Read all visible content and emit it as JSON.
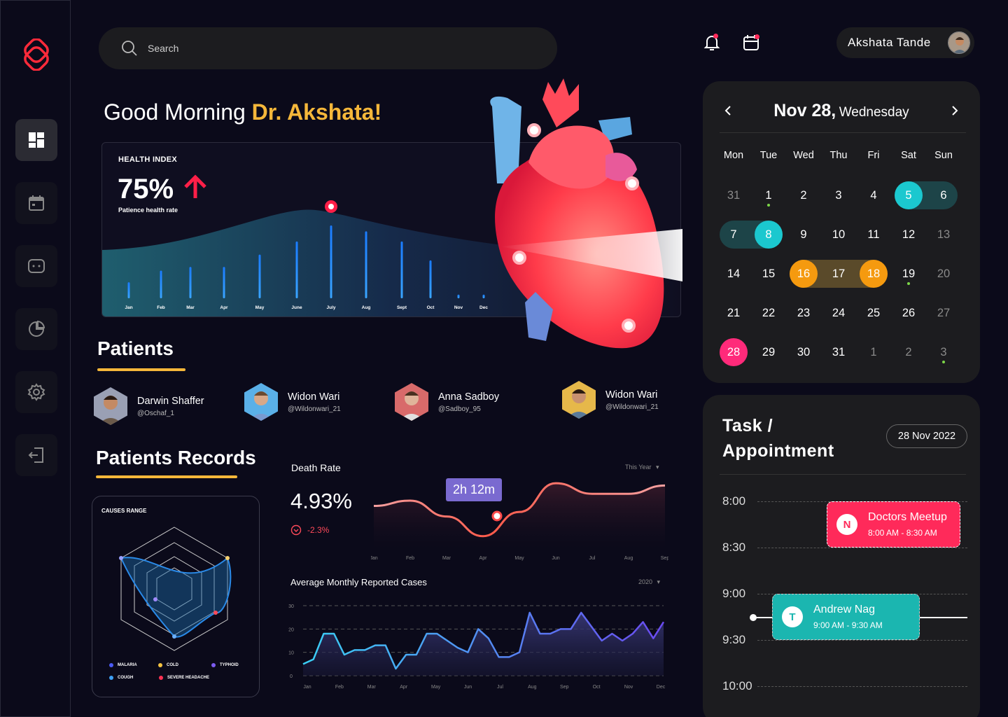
{
  "search": {
    "placeholder": "Search"
  },
  "user": {
    "name": "Akshata Tande"
  },
  "greeting": {
    "prefix": "Good Morning ",
    "name": "Dr. Akshata!"
  },
  "health_index": {
    "title": "HEALTH INDEX",
    "value": "75%",
    "subtitle": "Patience health rate",
    "chart_data": {
      "type": "bar",
      "categories": [
        "Jan",
        "Feb",
        "Mar",
        "Apr",
        "May",
        "June",
        "July",
        "Aug",
        "Sept",
        "Oct",
        "Nov",
        "Dec"
      ],
      "values": [
        22,
        38,
        43,
        43,
        60,
        78,
        100,
        92,
        78,
        52,
        5,
        5
      ],
      "highlight": "July"
    }
  },
  "patients": {
    "title": "Patients",
    "items": [
      {
        "name": "Darwin Shaffer",
        "handle": "@Oschaf_1"
      },
      {
        "name": "Widon Wari",
        "handle": "@Wildonwari_21"
      },
      {
        "name": "Anna Sadboy",
        "handle": "@Sadboy_95"
      },
      {
        "name": "Widon Wari",
        "handle": "@Wildonwari_21"
      }
    ]
  },
  "records": {
    "title": "Patients Records",
    "causes_title": "CAUSES RANGE",
    "legend": [
      {
        "label": "MALARIA",
        "color": "#4b5bf5"
      },
      {
        "label": "COLD",
        "color": "#f5c341"
      },
      {
        "label": "TYPHOID",
        "color": "#7c5cf0"
      },
      {
        "label": "COUGH",
        "color": "#3ea0f5"
      },
      {
        "label": "SEVERE HEADACHE",
        "color": "#ff3153"
      }
    ]
  },
  "death_rate": {
    "title": "Death Rate",
    "value": "4.93%",
    "change": "-2.3%",
    "filter": "This Year",
    "tooltip": "2h 12m",
    "chart_data": {
      "type": "line",
      "x": [
        "Jan",
        "Feb",
        "Mar",
        "Apr",
        "May",
        "Jun",
        "Jul",
        "Aug",
        "Sep"
      ],
      "values": [
        56,
        63,
        42,
        16,
        48,
        86,
        72,
        72,
        83
      ]
    }
  },
  "monthly_cases": {
    "title": "Average Monthly Reported Cases",
    "filter": "2020",
    "chart_data": {
      "type": "area",
      "x": [
        "Jan",
        "Feb",
        "Mar",
        "Apr",
        "May",
        "Jun",
        "Jul",
        "Aug",
        "Sep",
        "Oct",
        "Nov",
        "Dec"
      ],
      "y_ticks": [
        "30",
        "20",
        "10",
        "0"
      ],
      "ylim": [
        0,
        30
      ],
      "values": [
        5,
        7,
        18,
        18,
        9,
        11,
        11,
        13,
        13,
        3,
        9,
        9,
        18,
        18,
        15,
        12,
        10,
        20,
        16,
        8,
        8,
        10,
        27,
        18,
        18,
        20,
        20,
        27,
        21,
        15,
        18,
        15,
        18,
        23,
        16,
        23
      ]
    }
  },
  "calendar": {
    "month": "Nov 28,",
    "weekday": "Wednesday",
    "weekdays": [
      "Mon",
      "Tue",
      "Wed",
      "Thu",
      "Fri",
      "Sat",
      "Sun"
    ],
    "weeks": [
      [
        "31",
        "1",
        "2",
        "3",
        "4",
        "5",
        "6"
      ],
      [
        "7",
        "8",
        "9",
        "10",
        "11",
        "12",
        "13"
      ],
      [
        "14",
        "15",
        "16",
        "17",
        "18",
        "19",
        "20"
      ],
      [
        "21",
        "22",
        "23",
        "24",
        "25",
        "26",
        "27"
      ],
      [
        "28",
        "29",
        "30",
        "31",
        "1",
        "2",
        "3"
      ]
    ]
  },
  "tasks": {
    "title_line1": "Task /",
    "title_line2": "Appointment",
    "date": "28 Nov 2022",
    "times": [
      "8:00",
      "8:30",
      "9:00",
      "9:30",
      "10:00"
    ],
    "events": [
      {
        "initial": "N",
        "title": "Doctors Meetup",
        "time": "8:00 AM - 8:30 AM",
        "color": "#ff2a5a"
      },
      {
        "initial": "T",
        "title": "Andrew Nag",
        "time": "9:00 AM - 9:30 AM",
        "color": "#1bb6b0"
      }
    ]
  },
  "colors": {
    "accent": "#f5b73a",
    "teal": "#1bc8cf",
    "pink": "#ff2a7a",
    "orange": "#f59a0f"
  }
}
